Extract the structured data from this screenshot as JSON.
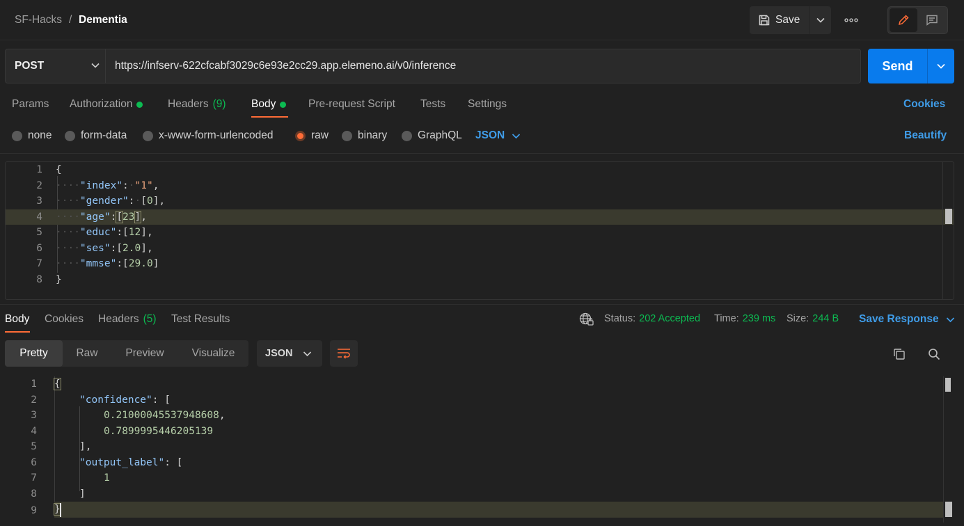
{
  "breadcrumb": {
    "parent": "SF-Hacks",
    "separator": "/",
    "title": "Dementia"
  },
  "toolbar": {
    "save_label": "Save",
    "more_icon": "ellipsis-icon",
    "edit_icon": "pencil-icon",
    "comment_icon": "comment-icon"
  },
  "request": {
    "method": "POST",
    "url": "https://infserv-622cfcabf3029c6e93e2cc29.app.elemeno.ai/v0/inference",
    "send_label": "Send"
  },
  "request_tabs": {
    "params": "Params",
    "authorization": "Authorization",
    "headers": "Headers",
    "headers_count": "(9)",
    "body": "Body",
    "prerequest": "Pre-request Script",
    "tests": "Tests",
    "settings": "Settings",
    "cookies": "Cookies"
  },
  "body_types": {
    "none": "none",
    "form_data": "form-data",
    "urlencoded": "x-www-form-urlencoded",
    "raw": "raw",
    "binary": "binary",
    "graphql": "GraphQL",
    "format": "JSON",
    "beautify": "Beautify"
  },
  "request_body": {
    "line_numbers": [
      "1",
      "2",
      "3",
      "4",
      "5",
      "6",
      "7",
      "8"
    ],
    "k_index": "\"index\"",
    "v_index": "\"1\"",
    "k_gender": "\"gender\"",
    "v_gender": "0",
    "k_age": "\"age\"",
    "v_age": "23",
    "k_educ": "\"educ\"",
    "v_educ": "12",
    "k_ses": "\"ses\"",
    "v_ses": "2.0",
    "k_mmse": "\"mmse\"",
    "v_mmse": "29.0"
  },
  "response_tabs": {
    "body": "Body",
    "cookies": "Cookies",
    "headers": "Headers",
    "headers_count": "(5)",
    "test_results": "Test Results"
  },
  "response_meta": {
    "status_label": "Status:",
    "status_value": "202 Accepted",
    "time_label": "Time:",
    "time_value": "239 ms",
    "size_label": "Size:",
    "size_value": "244 B",
    "save_response": "Save Response"
  },
  "response_view": {
    "pretty": "Pretty",
    "raw": "Raw",
    "preview": "Preview",
    "visualize": "Visualize",
    "format": "JSON"
  },
  "response_body": {
    "line_numbers": [
      "1",
      "2",
      "3",
      "4",
      "5",
      "6",
      "7",
      "8",
      "9"
    ],
    "k_confidence": "\"confidence\"",
    "v_conf_0": "0.21000045537948608",
    "v_conf_1": "0.7899995446205139",
    "k_output_label": "\"output_label\"",
    "v_label_0": "1"
  },
  "colors": {
    "accent": "#ff6c37",
    "send": "#097bed",
    "success": "#0cbb52",
    "link": "#3f9ce8"
  }
}
